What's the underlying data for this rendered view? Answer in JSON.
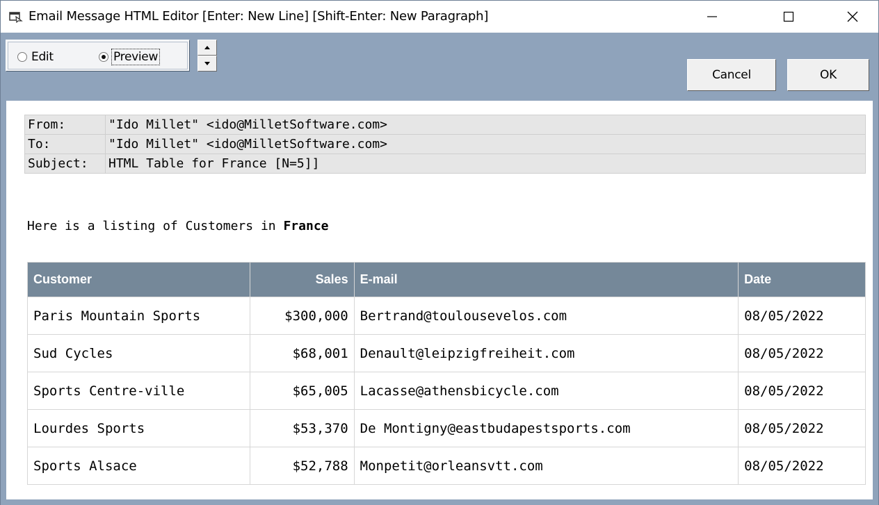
{
  "window": {
    "title": "Email Message HTML Editor  [Enter: New Line]  [Shift-Enter: New Paragraph]",
    "icon": "editor-app-icon",
    "controls": [
      "minimize-icon",
      "maximize-icon",
      "close-icon"
    ]
  },
  "toolbar": {
    "mode_edit_label": "Edit",
    "mode_preview_label": "Preview",
    "selected_mode": "Preview",
    "cancel_label": "Cancel",
    "ok_label": "OK"
  },
  "header": {
    "from_label": "From:",
    "from_value": "\"Ido Millet\" <ido@MilletSoftware.com>",
    "to_label": "To:",
    "to_value": "\"Ido Millet\" <ido@MilletSoftware.com>",
    "subject_label": "Subject:",
    "subject_value": "HTML Table for France [N=5]]"
  },
  "body": {
    "intro_text": "Here is a listing of Customers in ",
    "intro_bold": "France"
  },
  "table": {
    "columns": [
      "Customer",
      "Sales",
      "E-mail",
      "Date"
    ],
    "rows": [
      [
        "Paris Mountain Sports",
        "$300,000",
        "Bertrand@toulousevelos.com",
        "08/05/2022"
      ],
      [
        "Sud Cycles",
        "$68,001",
        "Denault@leipzigfreiheit.com",
        "08/05/2022"
      ],
      [
        "Sports Centre-ville",
        "$65,005",
        "Lacasse@athensbicycle.com",
        "08/05/2022"
      ],
      [
        "Lourdes Sports",
        "$53,370",
        "De Montigny@eastbudapestsports.com",
        "08/05/2022"
      ],
      [
        "Sports Alsace",
        "$52,788",
        "Monpetit@orleansvtt.com",
        "08/05/2022"
      ]
    ]
  },
  "colors": {
    "toolbar_bg": "#8fa3bb",
    "table_header_bg": "#758899",
    "email_header_bg": "#e6e6e6"
  }
}
